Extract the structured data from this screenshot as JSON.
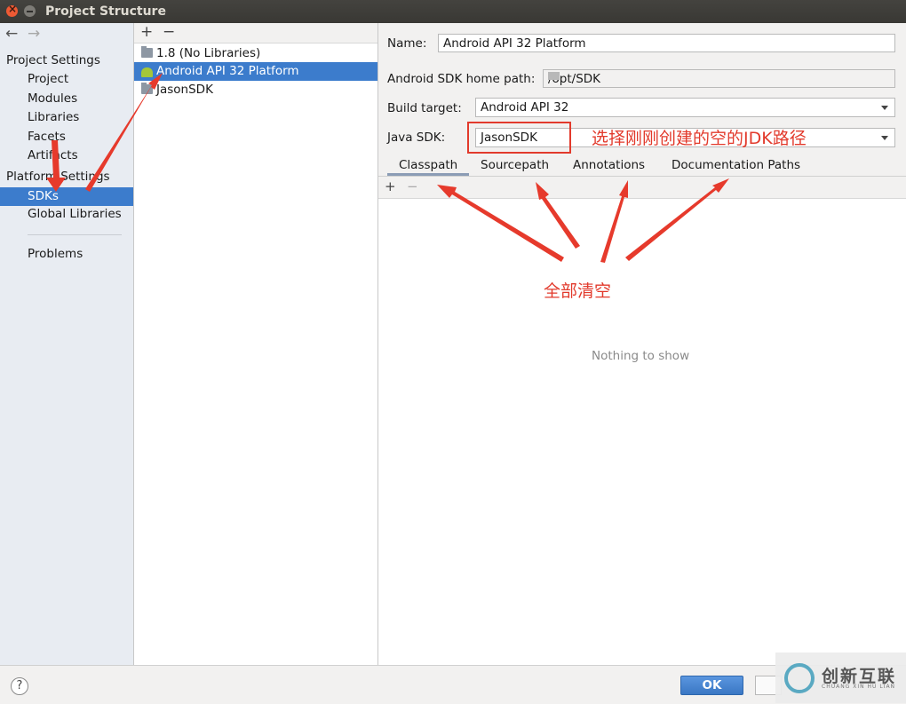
{
  "window": {
    "title": "Project Structure"
  },
  "nav": {
    "back_icon": "←",
    "forward_icon": "→"
  },
  "left_pane": {
    "project_settings_header": "Project Settings",
    "project_items": [
      "Project",
      "Modules",
      "Libraries",
      "Facets",
      "Artifacts"
    ],
    "platform_settings_header": "Platform Settings",
    "platform_items": [
      "SDKs",
      "Global Libraries"
    ],
    "selected_item": "SDKs",
    "problems": "Problems"
  },
  "sdk_list": {
    "add_icon": "+",
    "remove_icon": "−",
    "items": [
      {
        "label": "1.8 (No Libraries)",
        "icon": "folder-icon"
      },
      {
        "label": "Android API 32 Platform",
        "icon": "android-icon"
      },
      {
        "label": "JasonSDK",
        "icon": "folder-icon"
      }
    ],
    "selected_index": 1
  },
  "details": {
    "name_label": "Name:",
    "name_value": "Android API 32 Platform",
    "home_path_label": "Android SDK home path:",
    "home_path_value": "/opt/SDK",
    "build_target_label": "Build target:",
    "build_target_value": "Android API 32",
    "java_sdk_label": "Java SDK:",
    "java_sdk_value": "JasonSDK",
    "tabs": [
      "Classpath",
      "Sourcepath",
      "Annotations",
      "Documentation Paths"
    ],
    "active_tab": "Classpath",
    "list_add_icon": "+",
    "list_remove_icon": "−",
    "empty_text": "Nothing to show"
  },
  "footer": {
    "help": "?",
    "ok": "OK"
  },
  "annotations": {
    "select_jdk_note": "选择刚刚创建的空的JDK路径",
    "clear_all_note": "全部清空",
    "color": "#e23a2c"
  },
  "watermark": {
    "text_cn": "创新互联",
    "text_en": "CHUANG XIN HU LIAN"
  },
  "colors": {
    "selection": "#3c7ccc",
    "titlebar": "#3c3b37",
    "close_button": "#ee5a34"
  }
}
